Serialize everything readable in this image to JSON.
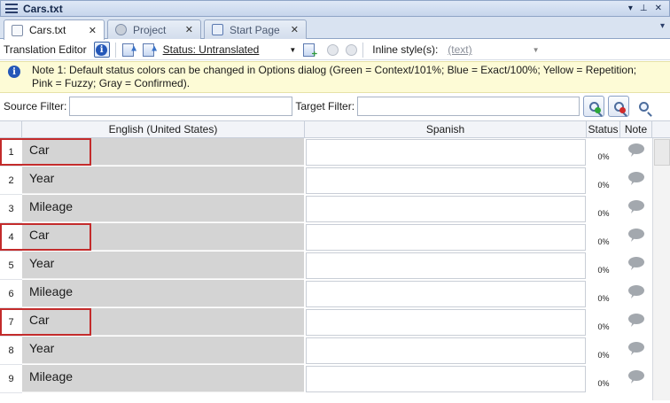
{
  "window": {
    "title": "Cars.txt",
    "controls": [
      "▾",
      "⊥",
      "✕"
    ]
  },
  "tabs": [
    {
      "label": "Cars.txt",
      "close": "✕"
    },
    {
      "label": "Project",
      "close": "✕"
    },
    {
      "label": "Start Page",
      "close": "✕"
    }
  ],
  "tab_overflow": "▾",
  "toolbar": {
    "editor_label": "Translation Editor",
    "info_glyph": "i",
    "status_label": "Status: Untranslated",
    "dropdown_arrow": "▼",
    "inline_label": "Inline style(s):",
    "inline_value": "(text)"
  },
  "note": {
    "icon_glyph": "i",
    "text": "Note 1: Default status colors can be changed in Options dialog (Green = Context/101%; Blue = Exact/100%; Yellow = Repetition; Pink = Fuzzy; Gray = Confirmed)."
  },
  "filters": {
    "source_label": "Source Filter:",
    "source_value": "",
    "target_label": "Target Filter:",
    "target_value": ""
  },
  "grid": {
    "columns": [
      "English (United States)",
      "Spanish",
      "Status",
      "Note"
    ],
    "rows": [
      {
        "num": "1",
        "source": "Car",
        "target": "",
        "status": "0%",
        "highlighted": true
      },
      {
        "num": "2",
        "source": "Year",
        "target": "",
        "status": "0%",
        "highlighted": false
      },
      {
        "num": "3",
        "source": "Mileage",
        "target": "",
        "status": "0%",
        "highlighted": false
      },
      {
        "num": "4",
        "source": "Car",
        "target": "",
        "status": "0%",
        "highlighted": true
      },
      {
        "num": "5",
        "source": "Year",
        "target": "",
        "status": "0%",
        "highlighted": false
      },
      {
        "num": "6",
        "source": "Mileage",
        "target": "",
        "status": "0%",
        "highlighted": false
      },
      {
        "num": "7",
        "source": "Car",
        "target": "",
        "status": "0%",
        "highlighted": true
      },
      {
        "num": "8",
        "source": "Year",
        "target": "",
        "status": "0%",
        "highlighted": false
      },
      {
        "num": "9",
        "source": "Mileage",
        "target": "",
        "status": "0%",
        "highlighted": false
      }
    ]
  },
  "colors": {
    "highlight_border": "#c32b2b",
    "source_cell_bg": "#d4d4d4",
    "note_bar_bg": "#fdfbd6",
    "filter_green": "#2ea83a",
    "filter_red": "#d12b2b"
  }
}
